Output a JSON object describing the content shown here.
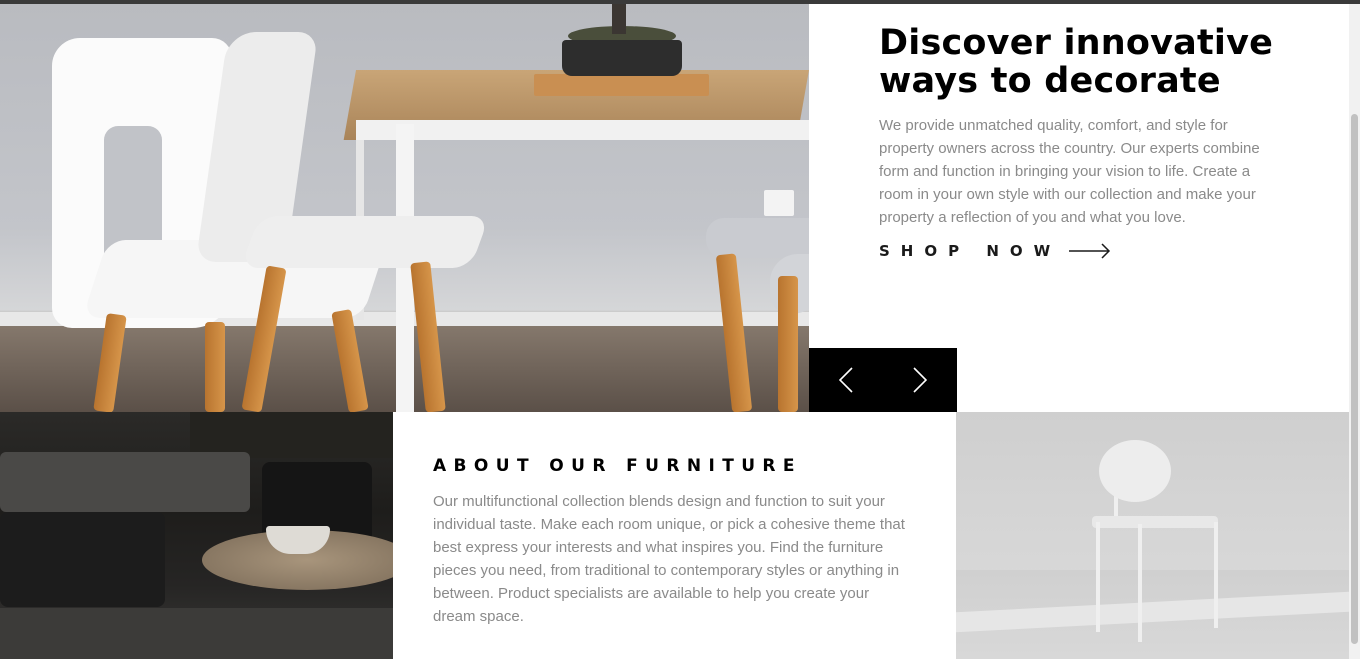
{
  "hero": {
    "title_line1": "Discover innovative",
    "title_line2": "ways to decorate",
    "description": "We provide unmatched quality, comfort, and style for property owners across the country. Our experts combine form and function in bringing your vision to life. Create a room in your own style with our collection and make your property a reflection of you and what you love.",
    "cta_label": "SHOP NOW"
  },
  "slider": {
    "prev_icon": "chevron-left-icon",
    "next_icon": "chevron-right-icon"
  },
  "about": {
    "title": "ABOUT OUR FURNITURE",
    "description": "Our multifunctional collection blends design and function to suit your individual taste. Make each room unique, or pick a cohesive theme that best express your interests and what inspires you. Find the furniture pieces you need, from traditional to contemporary styles or anything in between. Product specialists are available to help you create your dream space."
  },
  "colors": {
    "text_dark": "#000000",
    "text_muted": "#8a8a8a",
    "control_bg": "#000000"
  }
}
